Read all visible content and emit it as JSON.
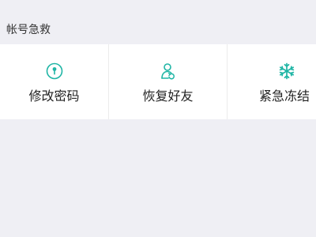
{
  "section": {
    "title": "帐号急救"
  },
  "tiles": [
    {
      "label": "修改密码",
      "icon": "key-circle-icon"
    },
    {
      "label": "恢复好友",
      "icon": "friend-recover-icon"
    },
    {
      "label": "紧急冻结",
      "icon": "snowflake-icon"
    }
  ],
  "colors": {
    "accent": "#1fb5a5",
    "background": "#efeff4",
    "tile_background": "#ffffff"
  }
}
